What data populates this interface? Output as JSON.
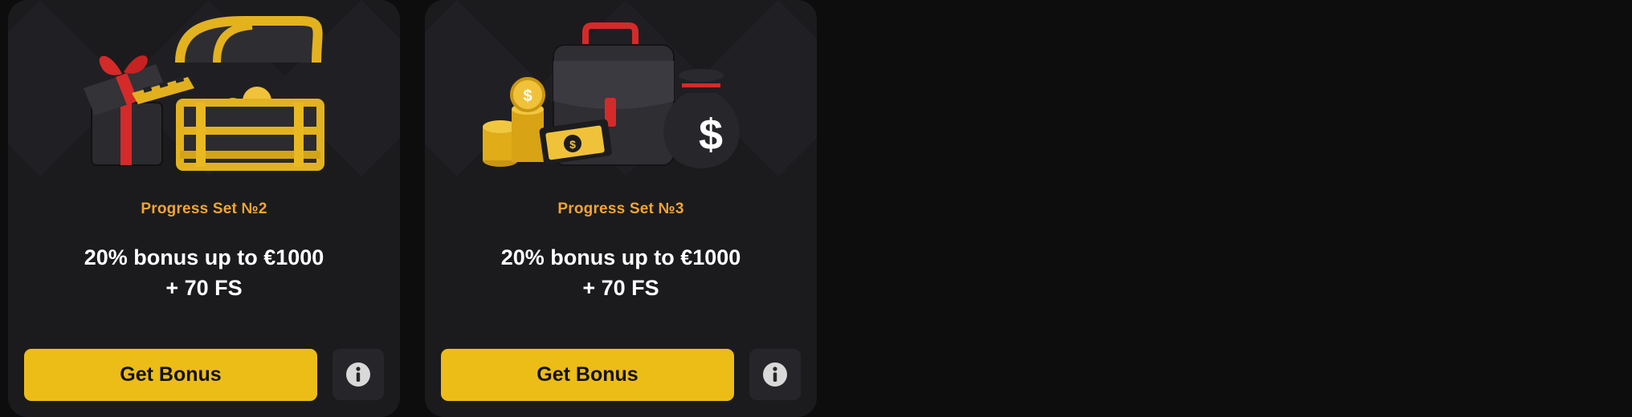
{
  "colors": {
    "page_background": "#0d0d0e",
    "card_background": "#1b1b1e",
    "title_orange": "#f2a531",
    "button_yellow": "#ecbd17",
    "info_button_background": "#26262a"
  },
  "cards": [
    {
      "title": "Progress Set №2",
      "offer_line1": "20% bonus up to €1000",
      "offer_line2": "+ 70 FS",
      "button_label": "Get Bonus",
      "image": "gift-box-and-treasure-chest-illustration",
      "info_icon": "info-icon"
    },
    {
      "title": "Progress Set №3",
      "offer_line1": "20% bonus up to €1000",
      "offer_line2": "+ 70 FS",
      "button_label": "Get Bonus",
      "image": "briefcase-coins-money-bag-illustration",
      "info_icon": "info-icon"
    }
  ]
}
